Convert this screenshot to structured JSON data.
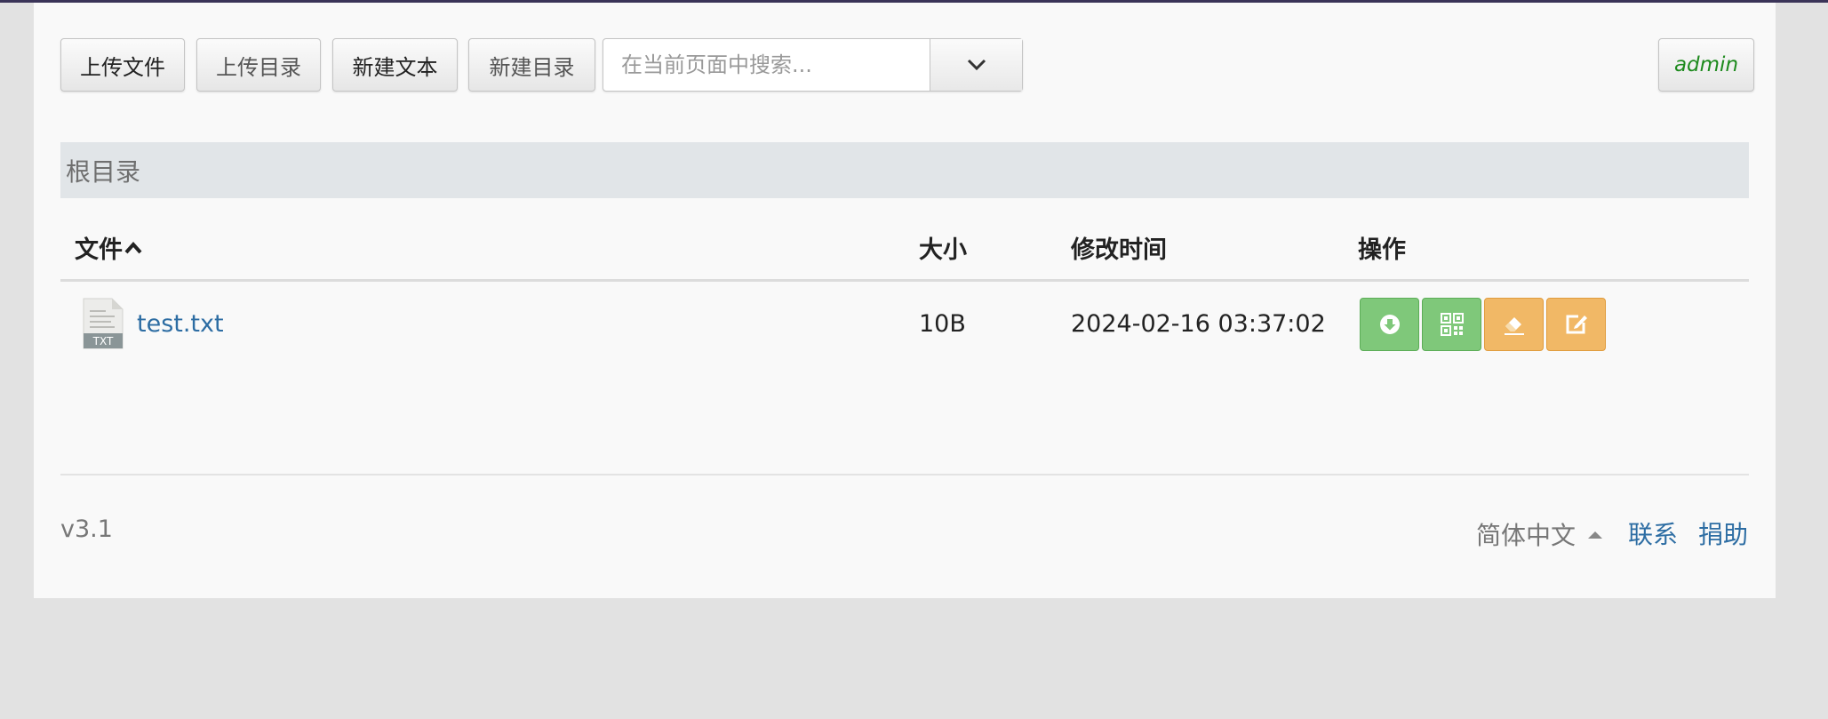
{
  "toolbar": {
    "upload_file": "上传文件",
    "upload_dir": "上传目录",
    "new_text": "新建文本",
    "new_dir": "新建目录",
    "search_placeholder": "在当前页面中搜索...",
    "user": "admin"
  },
  "breadcrumb": "根目录",
  "table": {
    "headers": {
      "file": "文件",
      "size": "大小",
      "modified": "修改时间",
      "actions": "操作"
    },
    "rows": [
      {
        "icon_label": "TXT",
        "name": "test.txt",
        "size": "10B",
        "modified": "2024-02-16 03:37:02"
      }
    ]
  },
  "footer": {
    "version": "v3.1",
    "language": "简体中文",
    "contact": "联系",
    "donate": "捐助"
  },
  "colors": {
    "accent_link": "#2d6da3",
    "action_green": "#7fc87a",
    "action_orange": "#f1b866",
    "user_green": "#1d8a1d"
  },
  "icons": {
    "sort": "chevron-up-icon",
    "search_dropdown": "chevron-down-icon",
    "download": "download-icon",
    "qrcode": "qrcode-icon",
    "rename": "eraser-icon",
    "edit": "edit-icon",
    "file_type": "txt-file-icon"
  }
}
